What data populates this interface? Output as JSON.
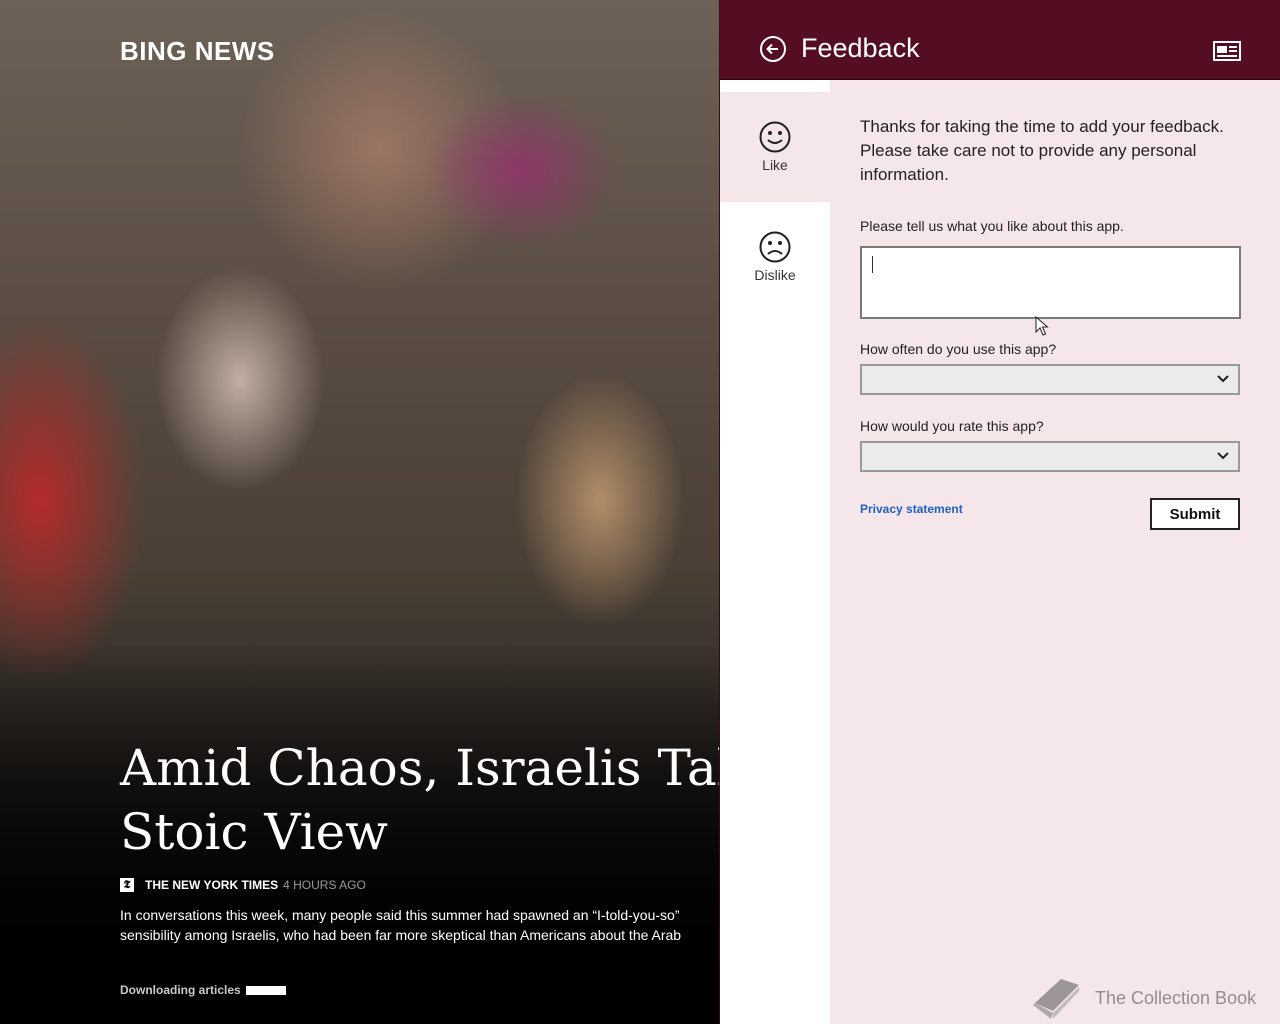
{
  "news": {
    "brand": "BING NEWS",
    "headline_line1": "Amid Chaos, Israelis Take",
    "headline_line2": "Stoic View",
    "source_icon_glyph": "𝕿",
    "source": "THE NEW YORK TIMES",
    "age": "4 HOURS AGO",
    "summary_line1": "In conversations this week, many people said this summer had spawned an “I-told-you-so”",
    "summary_line2": "sensibility among Israelis, who had been far more skeptical than Americans about the Arab",
    "downloading": "Downloading articles",
    "download_progress": 1.0
  },
  "feedback": {
    "title": "Feedback",
    "back_icon": "back-arrow-circle-icon",
    "header_icon": "reading-view-icon",
    "nav": [
      {
        "label": "Like",
        "icon": "smile-icon",
        "selected": true
      },
      {
        "label": "Dislike",
        "icon": "frown-icon",
        "selected": false
      }
    ],
    "intro": "Thanks for taking the time to add your feedback. Please take care not to provide any personal information.",
    "like_prompt": "Please tell us what you like about this app.",
    "like_value": "",
    "frequency_label": "How often do you use this app?",
    "frequency_value": "",
    "rating_label": "How would you rate this app?",
    "rating_value": "",
    "privacy_link": "Privacy statement",
    "submit_label": "Submit",
    "accent_color": "#540d21",
    "panel_color": "#f5e6ea",
    "link_color": "#1f61c4"
  },
  "watermark": {
    "text": "The Collection Book"
  }
}
